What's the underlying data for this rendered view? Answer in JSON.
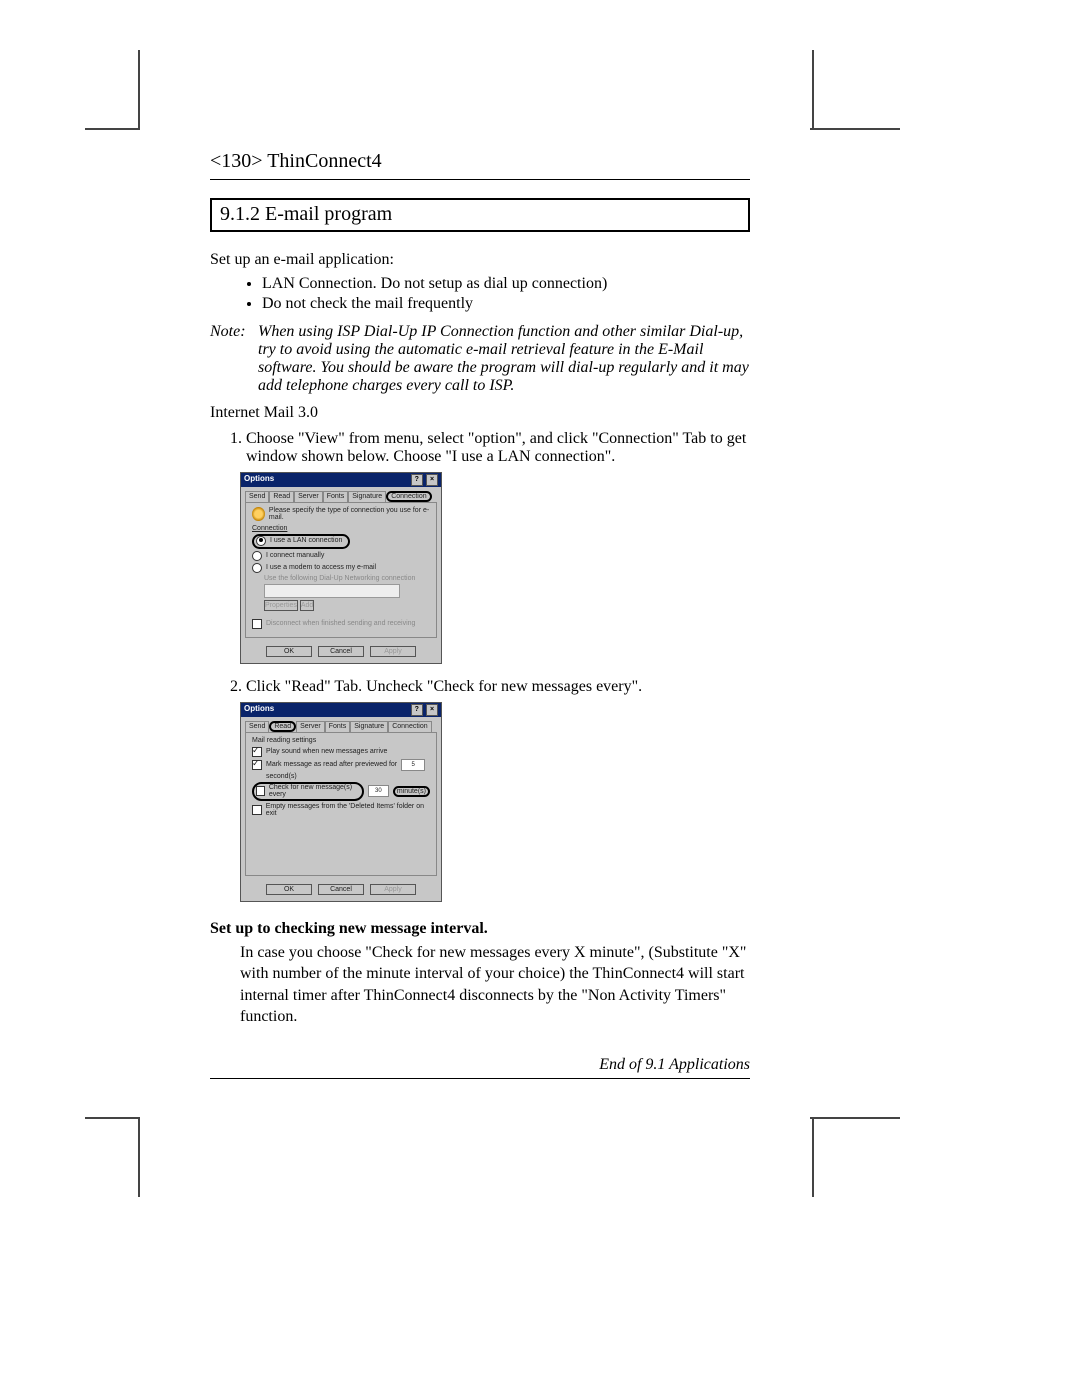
{
  "header": {
    "page_num": "<130>",
    "product": "ThinConnect4"
  },
  "section": {
    "number": "9.1.2",
    "title": "E-mail program"
  },
  "intro": "Set up an e-mail application:",
  "bullets": [
    "LAN Connection. Do not setup as dial up connection)",
    "Do not check the mail frequently"
  ],
  "note": {
    "label": "Note:",
    "text": "When using ISP Dial-Up IP Connection function and other similar Dial-up, try to avoid using the automatic e-mail retrieval feature in the E-Mail software. You should be aware the program will dial-up regularly and it may add telephone charges every call to ISP."
  },
  "app_name": "Internet Mail 3.0",
  "steps": [
    "Choose \"View\" from menu, select \"option\", and click \"Connection\" Tab to get window shown below. Choose \"I use a LAN connection\".",
    "Click \"Read\" Tab. Uncheck \"Check for new messages every\"."
  ],
  "dialog1": {
    "title": "Options",
    "tabs": [
      "Send",
      "Read",
      "Server",
      "Fonts",
      "Signature",
      "Connection"
    ],
    "active_tab": "Connection",
    "instruction": "Please specify the type of connection you use for e-mail.",
    "group": "Connection",
    "opt_lan": "I use a LAN connection",
    "opt_manual": "I connect manually",
    "opt_modem": "I use a modem to access my e-mail",
    "modem_hint": "Use the following Dial-Up Networking connection",
    "btn_props": "Properties",
    "btn_add": "Add",
    "disconnect": "Disconnect when finished sending and receiving",
    "ok": "OK",
    "cancel": "Cancel",
    "apply": "Apply"
  },
  "dialog2": {
    "title": "Options",
    "tabs": [
      "Send",
      "Read",
      "Server",
      "Fonts",
      "Signature",
      "Connection"
    ],
    "active_tab": "Read",
    "group": "Mail reading settings",
    "chk_sound": "Play sound when new messages arrive",
    "chk_mark": "Mark message as read after previewed for",
    "mark_val": "5",
    "mark_unit": "second(s)",
    "chk_check": "Check for new message(s) every",
    "check_val": "30",
    "check_unit": "minute(s)",
    "chk_empty": "Empty messages from the 'Deleted Items' folder on exit",
    "ok": "OK",
    "cancel": "Cancel",
    "apply": "Apply"
  },
  "sub_heading": "Set up to checking new message interval.",
  "sub_para": "In case you choose \"Check for new messages every X minute\",  (Substitute \"X\" with number of the minute interval of your choice)  the ThinConnect4 will start internal timer after ThinConnect4 disconnects by the \"Non Activity Timers\" function.",
  "end": "End of 9.1 Applications"
}
